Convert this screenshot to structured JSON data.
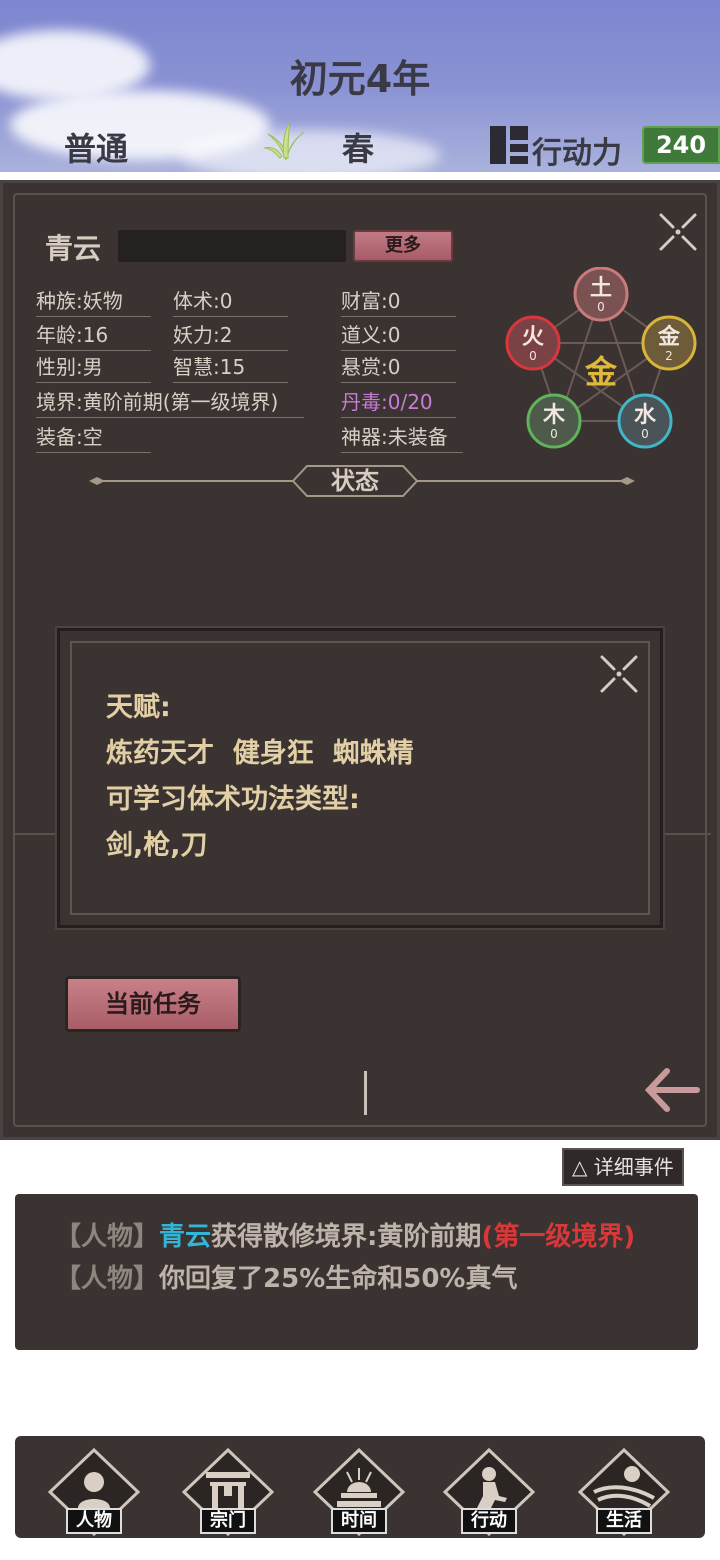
{
  "header": {
    "era": "初元4年",
    "mode": "普通",
    "season": "春",
    "action_label": "行动力",
    "action_value": "240"
  },
  "character": {
    "name": "青云",
    "more_button": "更多",
    "stats": {
      "race": "种族:妖物",
      "body_art": "体术:0",
      "wealth": "财富:0",
      "age": "年龄:16",
      "demon_power": "妖力:2",
      "righteousness": "道义:0",
      "gender": "性别:男",
      "wisdom": "智慧:15",
      "bounty": "悬赏:0",
      "realm": "境界:黄阶前期(第一级境界)",
      "pill_poison": "丹毒:0/20",
      "equipment": "装备:空",
      "artifact": "神器:未装备"
    },
    "wuxing": {
      "center": "金",
      "earth": {
        "label": "土",
        "value": "0",
        "color": "#c97a7a"
      },
      "fire": {
        "label": "火",
        "value": "0",
        "color": "#d9363e"
      },
      "metal": {
        "label": "金",
        "value": "2",
        "color": "#d8b43a"
      },
      "wood": {
        "label": "木",
        "value": "0",
        "color": "#5fb35a"
      },
      "water": {
        "label": "水",
        "value": "0",
        "color": "#41b6c8"
      }
    },
    "status_tab": "状态",
    "task_button": "当前任务"
  },
  "talent_popup": {
    "talent_heading": "天赋:",
    "talents": "炼药天才  健身狂  蜘蛛精",
    "learnable_heading": "可学习体术功法类型:",
    "learnable": "剑,枪,刀"
  },
  "events": {
    "detail_button": "△ 详细事件",
    "log": [
      {
        "tag": "【人物】",
        "name": "青云",
        "text": "获得散修境界:黄阶前期",
        "highlight": "(第一级境界)"
      },
      {
        "tag": "【人物】",
        "text": "你回复了25%生命和50%真气"
      }
    ]
  },
  "nav": {
    "items": [
      {
        "label": "人物",
        "icon": "person-icon"
      },
      {
        "label": "宗门",
        "icon": "gate-icon"
      },
      {
        "label": "时间",
        "icon": "sun-altar-icon"
      },
      {
        "label": "行动",
        "icon": "runner-icon"
      },
      {
        "label": "生活",
        "icon": "field-icon"
      }
    ]
  }
}
